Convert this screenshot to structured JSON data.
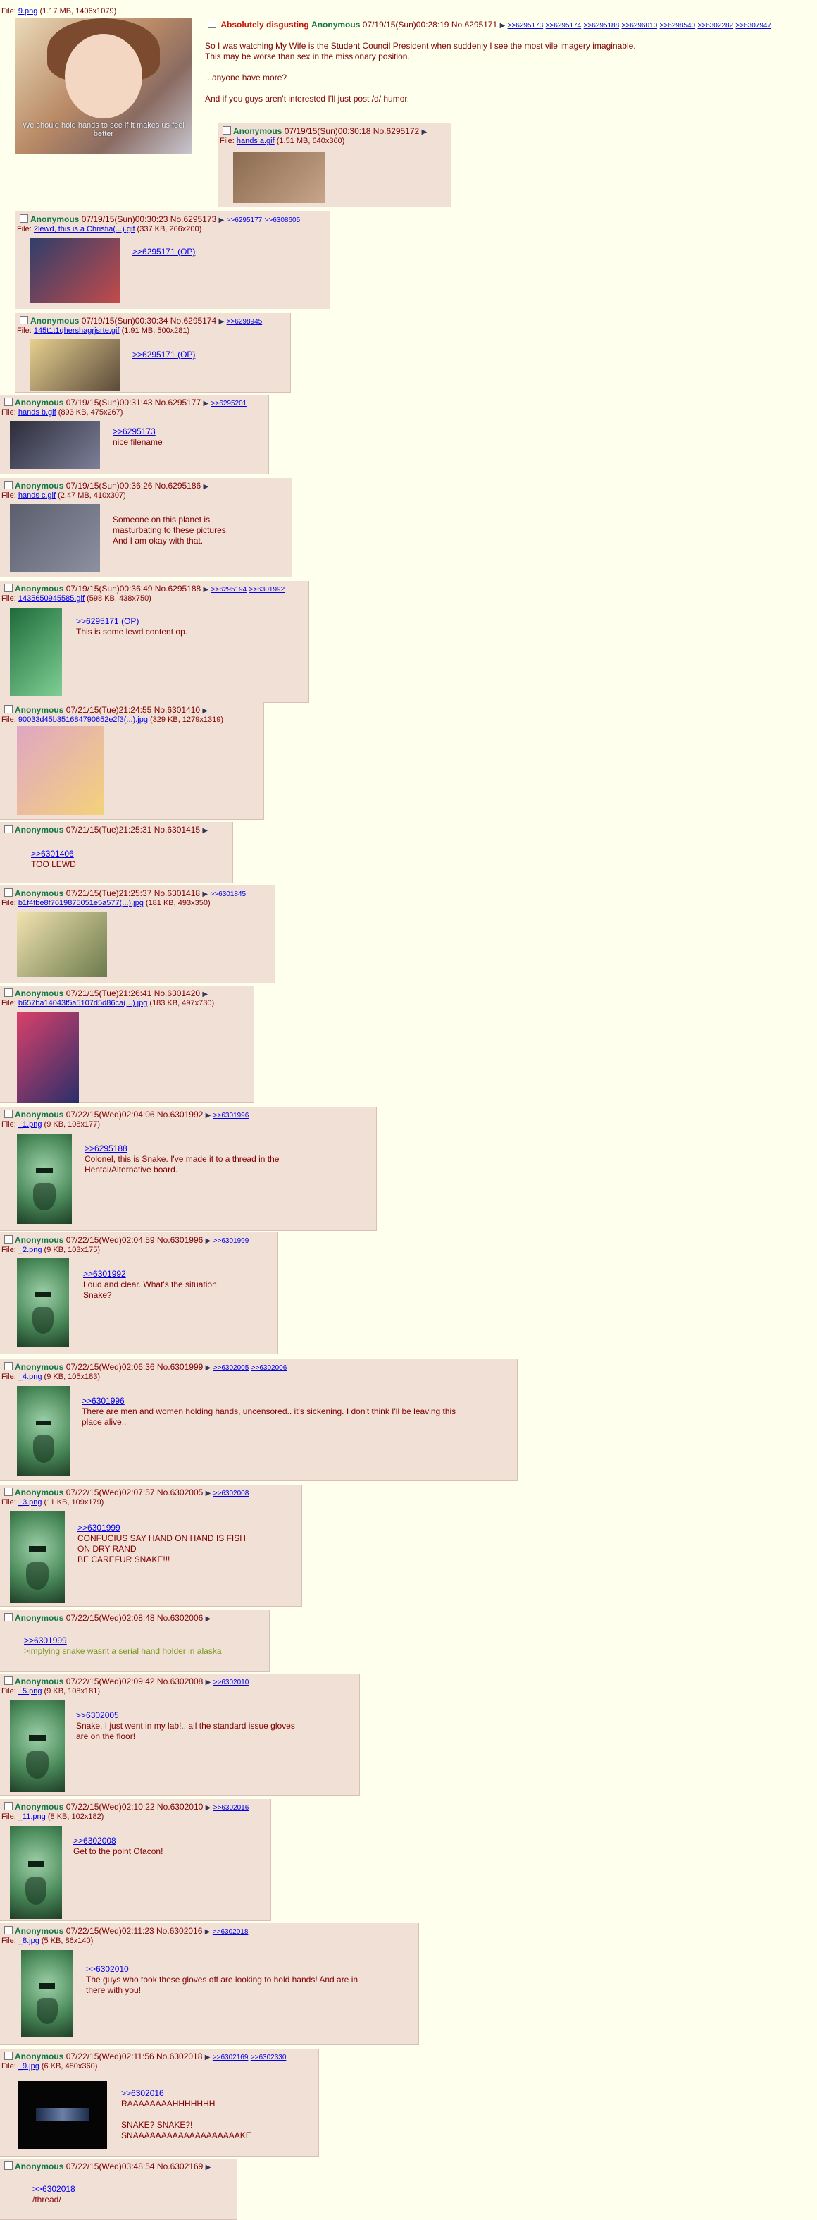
{
  "op": {
    "file_label": "File:",
    "file_name": "9.png",
    "file_info": "(1.17 MB, 1406x1079)",
    "subtitle_overlay": "We should hold hands to see if it makes us feel better",
    "subject": "Absolutely disgusting",
    "name": "Anonymous",
    "datetime": "07/19/15(Sun)00:28:19",
    "no": "No.6295171",
    "backlinks": [
      ">>6295173",
      ">>6295174",
      ">>6295188",
      ">>6296010",
      ">>6298540",
      ">>6302282",
      ">>6307947"
    ],
    "message": [
      "So I was watching My Wife is the Student Council President when suddenly I see the most vile imagery imaginable.",
      "This may be worse than sex in the missionary position.",
      "",
      "...anyone have more?",
      "",
      "And if you guys aren't interested I'll just post /d/ humor."
    ]
  },
  "replies": [
    {
      "name": "Anonymous",
      "datetime": "07/19/15(Sun)00:30:18",
      "no": "No.6295172",
      "backlinks": [],
      "file_name": "hands a.gif",
      "file_info": "(1.51 MB, 640x360)",
      "quote_link": "",
      "message": []
    },
    {
      "name": "Anonymous",
      "datetime": "07/19/15(Sun)00:30:23",
      "no": "No.6295173",
      "backlinks": [
        ">>6295177",
        ">>6308605"
      ],
      "file_name": "2lewd, this is a Christia(...).gif",
      "file_info": "(337 KB, 266x200)",
      "quote_link": ">>6295171 (OP)",
      "message": []
    },
    {
      "name": "Anonymous",
      "datetime": "07/19/15(Sun)00:30:34",
      "no": "No.6295174",
      "backlinks": [
        ">>6298945"
      ],
      "file_name": "145t1t1qhershagrjsrte.gif",
      "file_info": "(1.91 MB, 500x281)",
      "quote_link": ">>6295171 (OP)",
      "message": []
    },
    {
      "name": "Anonymous",
      "datetime": "07/19/15(Sun)00:31:43",
      "no": "No.6295177",
      "backlinks": [
        ">>6295201"
      ],
      "file_name": "hands b.gif",
      "file_info": "(893 KB, 475x267)",
      "quote_link": ">>6295173",
      "message": [
        "nice filename"
      ]
    },
    {
      "name": "Anonymous",
      "datetime": "07/19/15(Sun)00:36:26",
      "no": "No.6295186",
      "backlinks": [],
      "file_name": "hands c.gif",
      "file_info": "(2.47 MB, 410x307)",
      "quote_link": "",
      "message": [
        "Someone on this planet is",
        "masturbating to these pictures.",
        "And I am okay with that."
      ]
    },
    {
      "name": "Anonymous",
      "datetime": "07/19/15(Sun)00:36:49",
      "no": "No.6295188",
      "backlinks": [
        ">>6295194",
        ">>6301992"
      ],
      "file_name": "1435650945585.gif",
      "file_info": "(598 KB, 438x750)",
      "quote_link": ">>6295171 (OP)",
      "message": [
        "This is some lewd content op."
      ]
    },
    {
      "name": "Anonymous",
      "datetime": "07/21/15(Tue)21:24:55",
      "no": "No.6301410",
      "backlinks": [],
      "file_name": "90033d45b351684790652e2f3(...).jpg",
      "file_info": "(329 KB, 1279x1319)",
      "quote_link": "",
      "message": []
    },
    {
      "name": "Anonymous",
      "datetime": "07/21/15(Tue)21:25:31",
      "no": "No.6301415",
      "backlinks": [],
      "file_name": "",
      "file_info": "",
      "quote_link": ">>6301406",
      "message": [
        "TOO LEWD"
      ]
    },
    {
      "name": "Anonymous",
      "datetime": "07/21/15(Tue)21:25:37",
      "no": "No.6301418",
      "backlinks": [
        ">>6301845"
      ],
      "file_name": "b1f4fbe8f7619875051e5a577(...).jpg",
      "file_info": "(181 KB, 493x350)",
      "quote_link": "",
      "message": []
    },
    {
      "name": "Anonymous",
      "datetime": "07/21/15(Tue)21:26:41",
      "no": "No.6301420",
      "backlinks": [],
      "file_name": "b657ba14043f5a5107d5d86ca(...).jpg",
      "file_info": "(183 KB, 497x730)",
      "quote_link": "",
      "message": []
    },
    {
      "name": "Anonymous",
      "datetime": "07/22/15(Wed)02:04:06",
      "no": "No.6301992",
      "backlinks": [
        ">>6301996"
      ],
      "file_name": "_1.png",
      "file_info": "(9 KB, 108x177)",
      "quote_link": ">>6295188",
      "message": [
        "Colonel, this is Snake. I've made it to a thread in the",
        "Hentai/Alternative board."
      ]
    },
    {
      "name": "Anonymous",
      "datetime": "07/22/15(Wed)02:04:59",
      "no": "No.6301996",
      "backlinks": [
        ">>6301999"
      ],
      "file_name": "_2.png",
      "file_info": "(9 KB, 103x175)",
      "quote_link": ">>6301992",
      "message": [
        "Loud and clear. What's the situation",
        "Snake?"
      ]
    },
    {
      "name": "Anonymous",
      "datetime": "07/22/15(Wed)02:06:36",
      "no": "No.6301999",
      "backlinks": [
        ">>6302005",
        ">>6302006"
      ],
      "file_name": "_4.png",
      "file_info": "(9 KB, 105x183)",
      "quote_link": ">>6301996",
      "message": [
        "There are men and women holding hands, uncensored.. it's sickening. I don't think I'll be leaving this",
        "place alive.."
      ]
    },
    {
      "name": "Anonymous",
      "datetime": "07/22/15(Wed)02:07:57",
      "no": "No.6302005",
      "backlinks": [
        ">>6302008"
      ],
      "file_name": "_3.png",
      "file_info": "(11 KB, 109x179)",
      "quote_link": ">>6301999",
      "message": [
        "CONFUCIUS SAY HAND ON HAND IS FISH",
        "ON DRY RAND",
        "BE CAREFUR SNAKE!!!"
      ]
    },
    {
      "name": "Anonymous",
      "datetime": "07/22/15(Wed)02:08:48",
      "no": "No.6302006",
      "backlinks": [],
      "file_name": "",
      "file_info": "",
      "quote_link": ">>6301999",
      "greentext": ">implying snake wasnt a serial hand holder in alaska",
      "message": []
    },
    {
      "name": "Anonymous",
      "datetime": "07/22/15(Wed)02:09:42",
      "no": "No.6302008",
      "backlinks": [
        ">>6302010"
      ],
      "file_name": "_5.png",
      "file_info": "(9 KB, 108x181)",
      "quote_link": ">>6302005",
      "message": [
        "Snake, I just went in my lab!.. all the standard issue gloves",
        "are on the floor!"
      ]
    },
    {
      "name": "Anonymous",
      "datetime": "07/22/15(Wed)02:10:22",
      "no": "No.6302010",
      "backlinks": [
        ">>6302016"
      ],
      "file_name": "_11.png",
      "file_info": "(8 KB, 102x182)",
      "quote_link": ">>6302008",
      "message": [
        "Get to the point Otacon!"
      ]
    },
    {
      "name": "Anonymous",
      "datetime": "07/22/15(Wed)02:11:23",
      "no": "No.6302016",
      "backlinks": [
        ">>6302018"
      ],
      "file_name": "_8.jpg",
      "file_info": "(5 KB, 86x140)",
      "quote_link": ">>6302010",
      "message": [
        "The guys who took these gloves off are looking to hold hands! And are in",
        "there with you!"
      ]
    },
    {
      "name": "Anonymous",
      "datetime": "07/22/15(Wed)02:11:56",
      "no": "No.6302018",
      "backlinks": [
        ">>6302169",
        ">>6302330"
      ],
      "file_name": "_9.jpg",
      "file_info": "(6 KB, 480x360)",
      "quote_link": ">>6302016",
      "message": [
        "RAAAAAAAAHHHHHHH",
        "",
        "SNAKE? SNAKE?!",
        "SNAAAAAAAAAAAAAAAAAAAKE"
      ]
    },
    {
      "name": "Anonymous",
      "datetime": "07/22/15(Wed)03:48:54",
      "no": "No.6302169",
      "backlinks": [],
      "file_name": "",
      "file_info": "",
      "quote_link": ">>6302018",
      "message": [
        "/thread/"
      ]
    }
  ],
  "ui": {
    "file_label": "File:",
    "arrow": "▶",
    "reply_marker": ">>"
  }
}
